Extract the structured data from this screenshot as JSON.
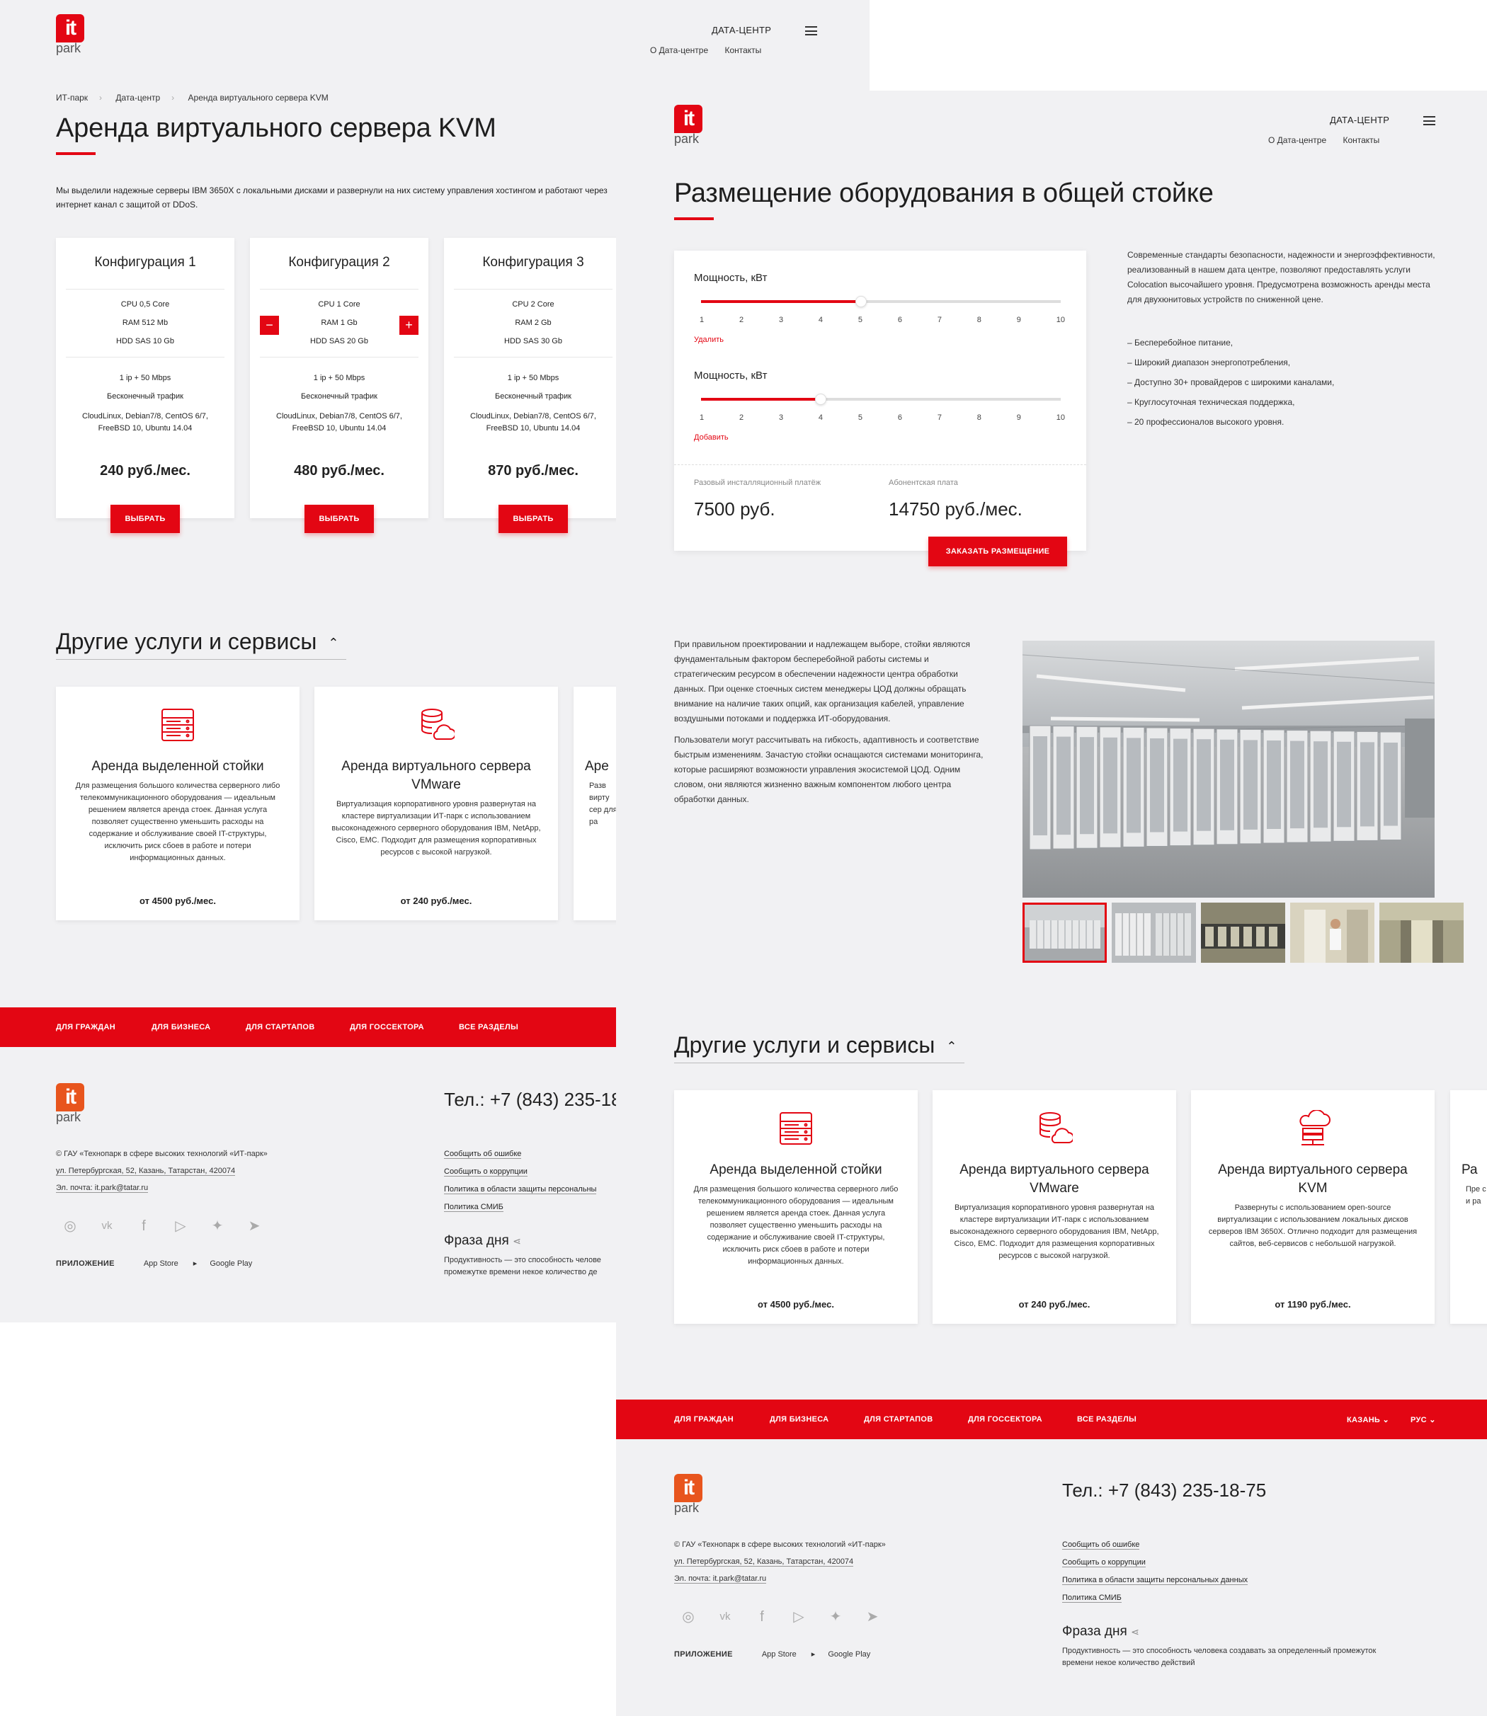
{
  "page1": {
    "logo": {
      "mark": "it",
      "text": "park"
    },
    "header": {
      "section": "ДАТА-ЦЕНТР",
      "links": [
        "О Дата-центре",
        "Контакты"
      ]
    },
    "breadcrumbs": [
      "ИТ-парк",
      "Дата-центр",
      "Аренда виртуального сервера KVM"
    ],
    "title": "Аренда виртуального сервера KVM",
    "intro": "Мы выделили надежные серверы IBM 3650X с локальными дисками и развернули на них систему управления хостингом и работают через интернет канал с защитой от DDoS.",
    "configs": [
      {
        "title": "Конфигурация 1",
        "cpu": "CPU 0,5 Core",
        "ram": "RAM 512 Mb",
        "hdd": "HDD SAS 10 Gb",
        "ip": "1 ip + 50 Mbps",
        "traffic": "Бесконечный трафик",
        "os": "CloudLinux, Debian7/8, CentOS 6/7, FreeBSD 10, Ubuntu 14.04",
        "price": "240 руб./мес.",
        "button": "ВЫБРАТЬ"
      },
      {
        "title": "Конфигурация 2",
        "cpu": "CPU 1 Core",
        "ram": "RAM 1 Gb",
        "hdd": "HDD SAS 20 Gb",
        "ip": "1 ip + 50 Mbps",
        "traffic": "Бесконечный трафик",
        "os": "CloudLinux, Debian7/8, CentOS 6/7, FreeBSD 10, Ubuntu 14.04",
        "price": "480 руб./мес.",
        "button": "ВЫБРАТЬ",
        "minus": "−",
        "plus": "+"
      },
      {
        "title": "Конфигурация 3",
        "cpu": "CPU 2 Core",
        "ram": "RAM 2 Gb",
        "hdd": "HDD SAS 30 Gb",
        "ip": "1 ip + 50 Mbps",
        "traffic": "Бесконечный трафик",
        "os": "CloudLinux, Debian7/8, CentOS 6/7, FreeBSD 10, Ubuntu 14.04",
        "price": "870 руб./мес.",
        "button": "ВЫБРАТЬ"
      }
    ],
    "others_title": "Другие услуги и сервисы",
    "services": [
      {
        "title": "Аренда выделенной стойки",
        "desc": "Для размещения большого количества серверного либо телекоммуникационного оборудования — идеальным решением является аренда стоек. Данная услуга позволяет существенно уменьшить расходы на содержание и обслуживание своей IT-структуры, исключить риск сбоев в работе и потери информационных данных.",
        "price": "от 4500 руб./мес."
      },
      {
        "title": "Аренда виртуального сервера VMware",
        "desc": "Виртуализация корпоративного уровня развернутая на кластере виртуализации ИТ-парк с использованием высоконадежного серверного оборудования IBM, NetApp, Cisco, EMC. Подходит для размещения корпоративных ресурсов с высокой нагрузкой.",
        "price": "от 240 руб./мес."
      },
      {
        "title": "Аре",
        "desc": "Разв вирту сер для ра"
      }
    ],
    "nav": [
      "ДЛЯ ГРАЖДАН",
      "ДЛЯ БИЗНЕСА",
      "ДЛЯ СТАРТАПОВ",
      "ДЛЯ ГОССЕКТОРА",
      "ВСЕ РАЗДЕЛЫ"
    ],
    "footer": {
      "org": "© ГАУ «Технопарк в сфере высоких технологий «ИТ-парк»",
      "address": "ул. Петербургская, 52, Казань, Татарстан, 420074",
      "email": "Эл. почта: it.park@tatar.ru",
      "tel": "Тел.: +7 (843) 235-18",
      "links": [
        "Сообщить об ошибке",
        "Сообщить о коррупции",
        "Политика в области защиты персональны",
        "Политика СМИБ"
      ],
      "phrase_title": "Фраза дня",
      "phrase": "Продуктивность — это способность челове промежутке времени некое количество де",
      "app_label": "ПРИЛОЖЕНИЕ",
      "app_store": "App Store",
      "google_play": "Google Play"
    }
  },
  "page2": {
    "logo": {
      "mark": "it",
      "text": "park"
    },
    "header": {
      "section": "ДАТА-ЦЕНТР",
      "links": [
        "О Дата-центре",
        "Контакты"
      ]
    },
    "title": "Размещение оборудования в общей стойке",
    "calculator": {
      "sliders": [
        {
          "label": "Мощность, кВт",
          "value": 5,
          "action": "Удалить"
        },
        {
          "label": "Мощность, кВт",
          "value": 4,
          "action": "Добавить"
        }
      ],
      "ticks": [
        "1",
        "2",
        "3",
        "4",
        "5",
        "6",
        "7",
        "8",
        "9",
        "10"
      ],
      "fee1_label": "Разовый инсталляционный платёж",
      "fee1": "7500 руб.",
      "fee2_label": "Абонентская плата",
      "fee2": "14750 руб./мес.",
      "button": "ЗАКАЗАТЬ РАЗМЕЩЕНИЕ"
    },
    "side_text": "Современные стандарты безопасности, надежности и энергоэффективности, реализованный в нашем дата центре, позволяют предоставлять услуги Colocation высочайшего уровня. Предусмотрена возможность аренды места для двухюнитовых устройств по сниженной цене.",
    "bullets": [
      "– Бесперебойное питание,",
      "– Широкий диапазон энергопотребления,",
      "– Доступно 30+ провайдеров с широкими каналами,",
      "– Круглосуточная техническая поддержка,",
      "– 20 профессионалов высокого уровня."
    ],
    "body_p1": "При правильном проектировании и надлежащем выборе, стойки являются фундаментальным фактором бесперебойной работы системы и стратегическим ресурсом в обеспечении надежности центра обработки данных. При оценке стоечных систем менеджеры ЦОД должны обращать внимание на наличие таких опций, как организация кабелей, управление воздушными потоками и поддержка ИТ-оборудования.",
    "body_p2": "Пользователи могут рассчитывать на гибкость, адаптивность и соответствие быстрым изменениям. Зачастую стойки оснащаются системами мониторинга, которые расширяют возможности управления экосистемой ЦОД. Одним словом, они являются жизненно важным компонентом любого центра обработки данных.",
    "others_title": "Другие услуги и сервисы",
    "services": [
      {
        "title": "Аренда выделенной стойки",
        "desc": "Для размещения большого количества серверного либо телекоммуникационного оборудования — идеальным решением является аренда стоек. Данная услуга позволяет существенно уменьшить расходы на содержание и обслуживание своей IT-структуры, исключить риск сбоев в работе и потери информационных данных.",
        "price": "от 4500 руб./мес."
      },
      {
        "title": "Аренда виртуального сервера VMware",
        "desc": "Виртуализация корпоративного уровня развернутая на кластере виртуализации ИТ-парк с использованием высоконадежного серверного оборудования IBM, NetApp, Cisco, EMC. Подходит для размещения корпоративных ресурсов с высокой нагрузкой.",
        "price": "от 240 руб./мес."
      },
      {
        "title": "Аренда виртуального сервера KVM",
        "desc": "Развернуты с использованием open-source виртуализации с использованием локальных дисков серверов IBM 3650X. Отлично подходит для размещения сайтов, веб-сервисов с небольшой нагрузкой.",
        "price": "от 1190 руб./мес."
      },
      {
        "title": "Ра",
        "desc": "Пре с и ра"
      }
    ],
    "nav": [
      "ДЛЯ ГРАЖДАН",
      "ДЛЯ БИЗНЕСА",
      "ДЛЯ СТАРТАПОВ",
      "ДЛЯ ГОССЕКТОРА",
      "ВСЕ РАЗДЕЛЫ"
    ],
    "city": "КАЗАНЬ ⌄",
    "lang": "РУС ⌄",
    "footer": {
      "org": "© ГАУ «Технопарк в сфере высоких технологий «ИТ-парк»",
      "address": "ул. Петербургская, 52, Казань, Татарстан, 420074",
      "email": "Эл. почта: it.park@tatar.ru",
      "tel": "Тел.: +7 (843) 235-18-75",
      "links": [
        "Сообщить об ошибке",
        "Сообщить о коррупции",
        "Политика в области защиты персональных данных",
        "Политика СМИБ"
      ],
      "phrase_title": "Фраза дня",
      "phrase": "Продуктивность — это способность человека создавать за определенный промежуток времени некое количество действий",
      "app_label": "ПРИЛОЖЕНИЕ",
      "app_store": "App Store",
      "google_play": "Google Play"
    }
  },
  "colors": {
    "accent": "#e30613",
    "background": "#f1f1f3"
  },
  "icons": [
    "menu-icon",
    "server-rack-icon",
    "database-cloud-icon",
    "cloud-server-icon",
    "instagram-icon",
    "vk-icon",
    "facebook-icon",
    "youtube-icon",
    "twitter-icon",
    "telegram-icon",
    "apple-icon",
    "google-play-icon",
    "share-icon",
    "chevron-up-icon"
  ]
}
